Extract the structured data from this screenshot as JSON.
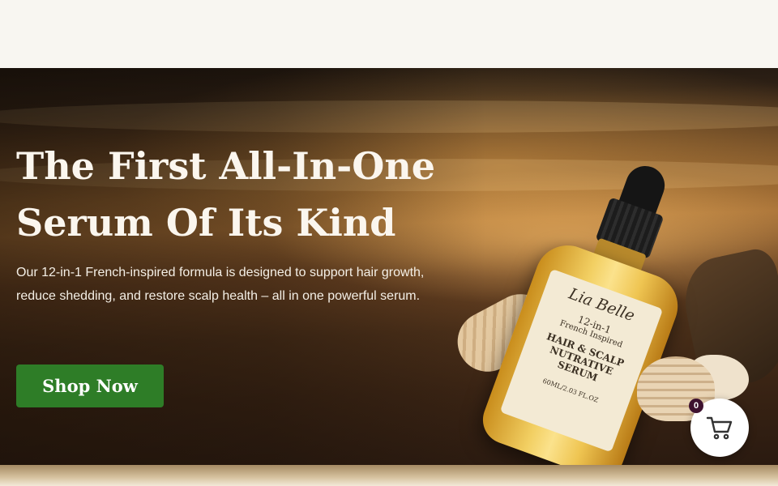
{
  "hero": {
    "title_line1": "The First All-In-One",
    "title_line2": "Serum Of Its Kind",
    "description": "Our 12-in-1 French-inspired formula is designed to support hair growth, reduce shedding, and restore scalp health – all in one powerful serum.",
    "cta_label": "Shop Now"
  },
  "product_label": {
    "brand": "Lia Belle",
    "line1": "12-in-1",
    "line2": "French Inspired",
    "line3": "HAIR & SCALP",
    "line4": "NUTRATIVE",
    "line5": "SERUM",
    "volume": "60ML/2.03 FL.OZ"
  },
  "cart": {
    "count": "0"
  },
  "colors": {
    "cta_green": "#2e7d27",
    "badge": "#3e1230",
    "top_bar": "#f8f6f1"
  },
  "icons": {
    "cart": "shopping-cart-icon"
  }
}
